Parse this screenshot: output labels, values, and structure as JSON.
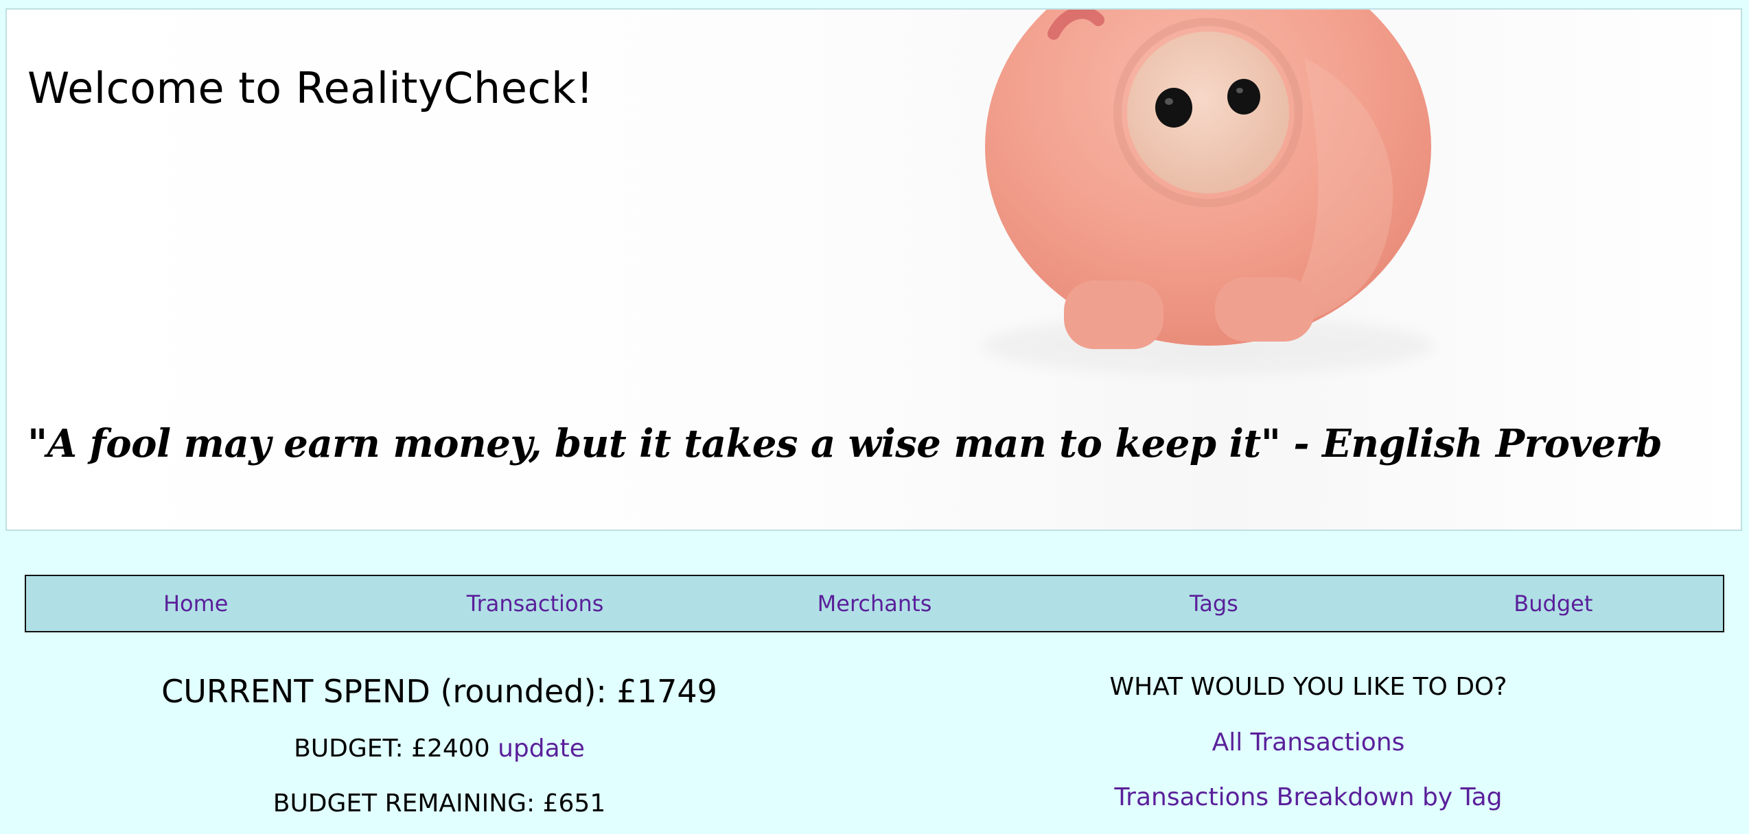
{
  "hero": {
    "title": "Welcome to RealityCheck!",
    "quote": "\"A fool may earn money, but it takes a wise man to keep it\" - English Proverb"
  },
  "nav": {
    "items": [
      {
        "label": "Home"
      },
      {
        "label": "Transactions"
      },
      {
        "label": "Merchants"
      },
      {
        "label": "Tags"
      },
      {
        "label": "Budget"
      }
    ]
  },
  "summary": {
    "current_spend_label": "CURRENT SPEND (rounded):",
    "current_spend_value": "£1749",
    "budget_label": "BUDGET:",
    "budget_value": "£2400",
    "update_link": "update",
    "remaining_label": "BUDGET REMAINING:",
    "remaining_value": "£651"
  },
  "actions": {
    "title": "WHAT WOULD YOU LIKE TO DO?",
    "links": [
      {
        "label": "All Transactions"
      },
      {
        "label": "Transactions Breakdown by Tag"
      }
    ]
  },
  "colors": {
    "page_background": "#e0fffe",
    "nav_background": "#b0e0e5",
    "link": "#5a1f9a",
    "pig": "#f2a58f"
  },
  "icons": {
    "hero_image": "piggy-bank-image"
  }
}
